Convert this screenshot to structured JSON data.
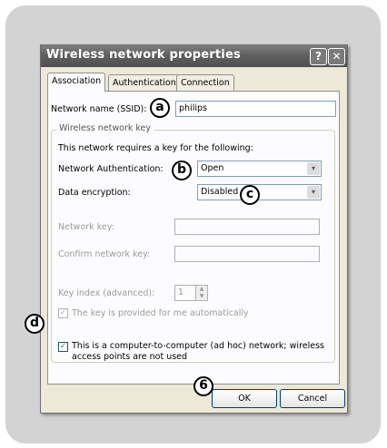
{
  "dialog": {
    "title": "Wireless network properties",
    "help_glyph": "?",
    "close_glyph": "✕"
  },
  "tabs": [
    {
      "label": "Association",
      "active": true
    },
    {
      "label": "Authentication",
      "active": false
    },
    {
      "label": "Connection",
      "active": false
    }
  ],
  "association": {
    "ssid_label": "Network name (SSID):",
    "ssid_value": "philips",
    "group_title": "Wireless network key",
    "key_required_text": "This network requires a key for the following:",
    "auth_label": "Network Authentication:",
    "auth_value": "Open",
    "encryption_label": "Data encryption:",
    "encryption_value": "Disabled",
    "network_key_label": "Network key:",
    "confirm_key_label": "Confirm network key:",
    "key_index_label": "Key index (advanced):",
    "key_index_value": "1",
    "auto_key_label": "The key is provided for me automatically",
    "adhoc_label_line1": "This is a computer-to-computer (ad hoc) network; wireless",
    "adhoc_label_line2": "access points are not used"
  },
  "buttons": {
    "ok": "OK",
    "cancel": "Cancel"
  },
  "callouts": {
    "a": "a",
    "b": "b",
    "c": "c",
    "d": "d",
    "six": "6"
  },
  "glyphs": {
    "dropdown_arrow": "▾",
    "checkmark": "✓",
    "spin_up": "▲",
    "spin_down": "▼"
  }
}
